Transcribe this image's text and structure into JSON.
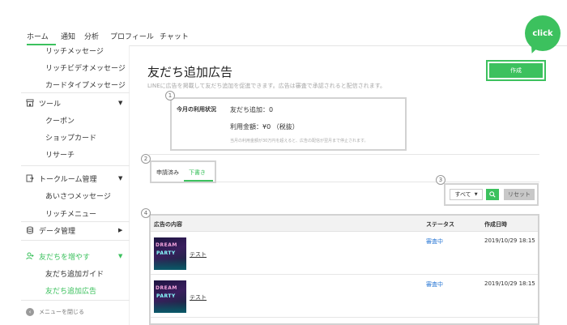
{
  "topnav": {
    "tabs": [
      "ホーム",
      "通知",
      "分析",
      "プロフィール",
      "チャット"
    ]
  },
  "sidebar": {
    "items": [
      {
        "label": "リッチメッセージ"
      },
      {
        "label": "リッチビデオメッセージ"
      },
      {
        "label": "カードタイプメッセージ"
      },
      {
        "label": "ツール",
        "icon": "store-icon"
      },
      {
        "label": "クーポン"
      },
      {
        "label": "ショップカード"
      },
      {
        "label": "リサーチ"
      },
      {
        "label": "トークルーム管理",
        "icon": "chat-room-icon"
      },
      {
        "label": "あいさつメッセージ"
      },
      {
        "label": "リッチメニュー"
      },
      {
        "label": "データ管理",
        "icon": "database-icon"
      },
      {
        "label": "友だちを増やす",
        "icon": "add-friend-icon"
      },
      {
        "label": "友だち追加ガイド"
      },
      {
        "label": "友だち追加広告"
      }
    ],
    "close_menu": "メニューを閉じる"
  },
  "main": {
    "title": "友だち追加広告",
    "description": "LINEに広告を掲載して友だち追加を促進できます。広告は審査で承認されると配信されます。",
    "create_button": "作成",
    "click_bubble": "click",
    "markers": [
      "1",
      "2",
      "3",
      "4"
    ],
    "usage": {
      "label": "今月の利用状況",
      "friends_added": "友だち追加：0",
      "amount": "利用金額：¥0 （税抜）",
      "note": "当月の利用金額が30万円を超えると、広告の配信が翌月まで停止されます。"
    },
    "tabs": [
      "申請済み",
      "下書き"
    ],
    "filter": {
      "select_value": "すべて",
      "reset": "リセット"
    },
    "table": {
      "headers": [
        "広告の内容",
        "ステータス",
        "作成日時"
      ],
      "rows": [
        {
          "name": "テスト",
          "status": "審査中",
          "date": "2019/10/29 18:15",
          "thumb_top": "DREAM",
          "thumb_bottom": "PARTY"
        },
        {
          "name": "テスト",
          "status": "審査中",
          "date": "2019/10/29 18:15",
          "thumb_top": "DREAM",
          "thumb_bottom": "PARTY"
        }
      ]
    }
  },
  "colors": {
    "accent": "#3cc15e",
    "status": "#2d7ad6"
  }
}
